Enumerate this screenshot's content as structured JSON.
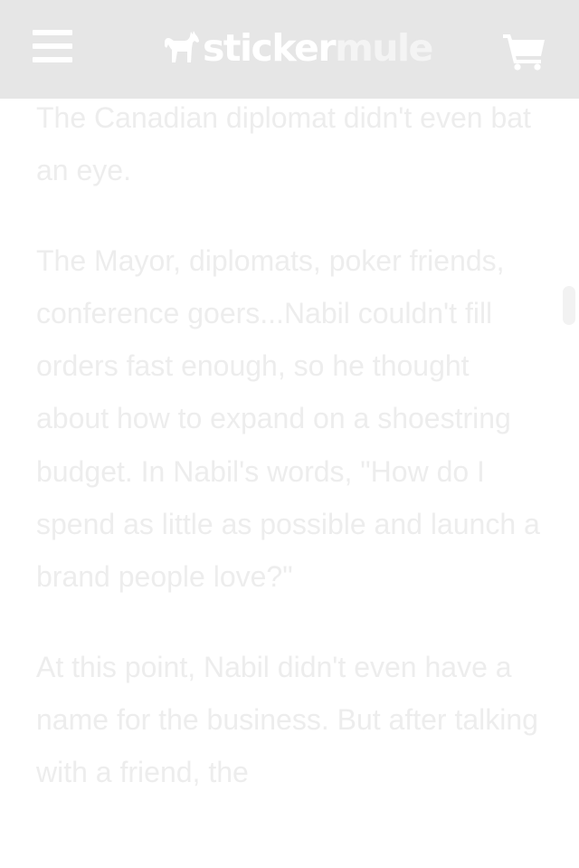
{
  "header": {
    "brand_part1": "sticker",
    "brand_part2": "mule",
    "menu_icon": "hamburger-icon",
    "cart_icon": "shopping-cart-icon",
    "logo_icon": "mule-logo-icon",
    "background_color": "#e6e6e6"
  },
  "article": {
    "paragraphs": [
      "The Canadian diplomat didn't even bat an eye.",
      "The Mayor, diplomats, poker friends, conference goers...Nabil couldn't fill orders fast enough, so he thought about how to expand on a shoestring budget. In Nabil's words, \"How do I spend as little as possible and launch a brand people love?\"",
      "At this point, Nabil didn't even have a name for the business. But after talking with a friend, the"
    ],
    "text_color": "#ededed"
  }
}
